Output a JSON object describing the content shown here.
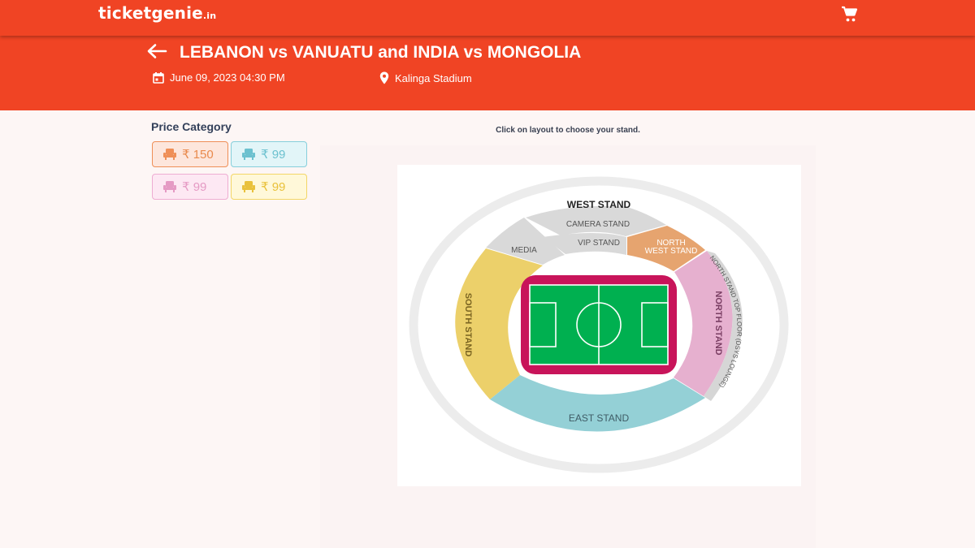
{
  "brand": {
    "name": "ticketgenie",
    "suffix": ".in"
  },
  "header": {
    "title": "LEBANON vs VANUATU and INDIA vs MONGOLIA",
    "date": "June 09, 2023 04:30 PM",
    "venue": "Kalinga Stadium"
  },
  "price_category": {
    "title": "Price Category",
    "options": [
      {
        "price": "₹ 150",
        "color": "#ef8f57"
      },
      {
        "price": "₹ 99",
        "color": "#6cc1cf"
      },
      {
        "price": "₹ 99",
        "color": "#e59ac4"
      },
      {
        "price": "₹ 99",
        "color": "#e9c13b"
      }
    ]
  },
  "layout_hint": "Click on layout to choose your stand.",
  "stands": {
    "west": "WEST STAND",
    "camera": "CAMERA STAND",
    "vip": "VIP STAND",
    "media": "MEDIA",
    "north_west_line1": "NORTH",
    "north_west_line2": "WEST STAND",
    "south": "SOUTH STAND",
    "north": "NORTH STAND",
    "north_top": "NORTH STAND TOP FLOOR (DSYS LOUNGE)",
    "east": "EAST STAND"
  },
  "colors": {
    "brand": "#f04424",
    "south_stand": "#ecd06a",
    "east_stand": "#94d0d6",
    "north_stand": "#e6b0cf",
    "north_west_stand": "#e6a46f",
    "grey_stands": "#d9d9d9",
    "pitch": "#00b050",
    "pitch_border": "#c8145a"
  }
}
